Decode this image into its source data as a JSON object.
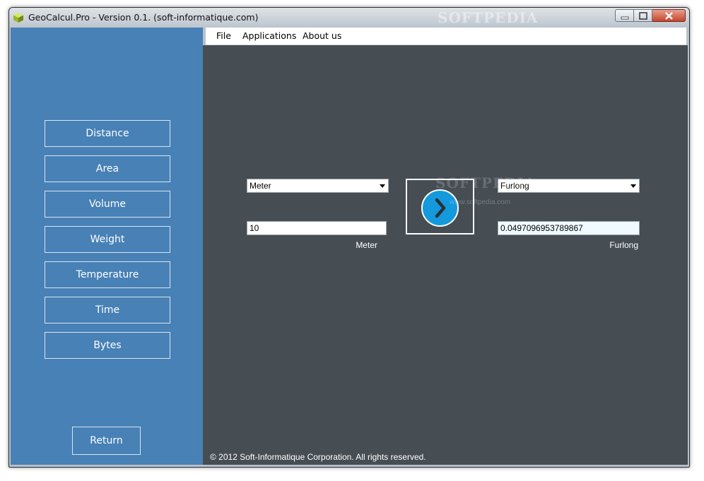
{
  "window": {
    "title": "GeoCalcul.Pro - Version 0.1. (soft-informatique.com)",
    "watermark": "SOFTPEDIA"
  },
  "menu": {
    "items": [
      "File",
      "Applications",
      "About us"
    ]
  },
  "sidebar": {
    "items": [
      {
        "label": "Distance"
      },
      {
        "label": "Area"
      },
      {
        "label": "Volume"
      },
      {
        "label": "Weight"
      },
      {
        "label": "Temperature"
      },
      {
        "label": "Time"
      },
      {
        "label": "Bytes"
      }
    ],
    "return_label": "Return"
  },
  "converter": {
    "from_unit": "Meter",
    "to_unit": "Furlong",
    "input_value": "10",
    "result_value": "0.0497096953789867",
    "from_label": "Meter",
    "to_label": "Furlong"
  },
  "watermark": {
    "logo": "SOFTPEDIA",
    "url": "www.softpedia.com"
  },
  "footer": {
    "copyright": "© 2012 Soft-Informatique Corporation. All rights reserved."
  },
  "colors": {
    "sidebar": "#4781b5",
    "content": "#464d53",
    "accent": "#1499dd"
  }
}
